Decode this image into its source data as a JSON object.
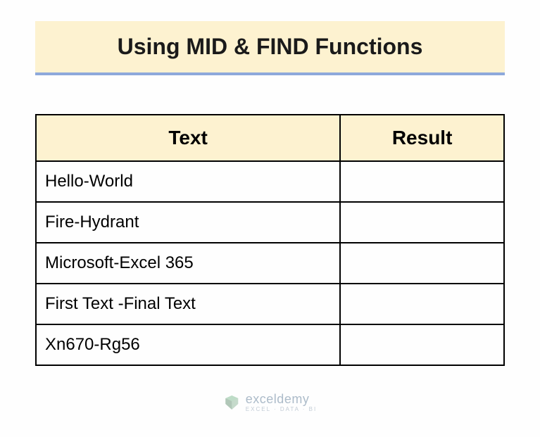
{
  "title": "Using MID & FIND Functions",
  "table": {
    "headers": {
      "text": "Text",
      "result": "Result"
    },
    "rows": [
      {
        "text": "Hello-World",
        "result": ""
      },
      {
        "text": "Fire-Hydrant",
        "result": ""
      },
      {
        "text": "Microsoft-Excel 365",
        "result": ""
      },
      {
        "text": "First Text -Final Text",
        "result": ""
      },
      {
        "text": "Xn670-Rg56",
        "result": ""
      }
    ]
  },
  "watermark": {
    "brand": "exceldemy",
    "tagline": "EXCEL · DATA · BI"
  }
}
